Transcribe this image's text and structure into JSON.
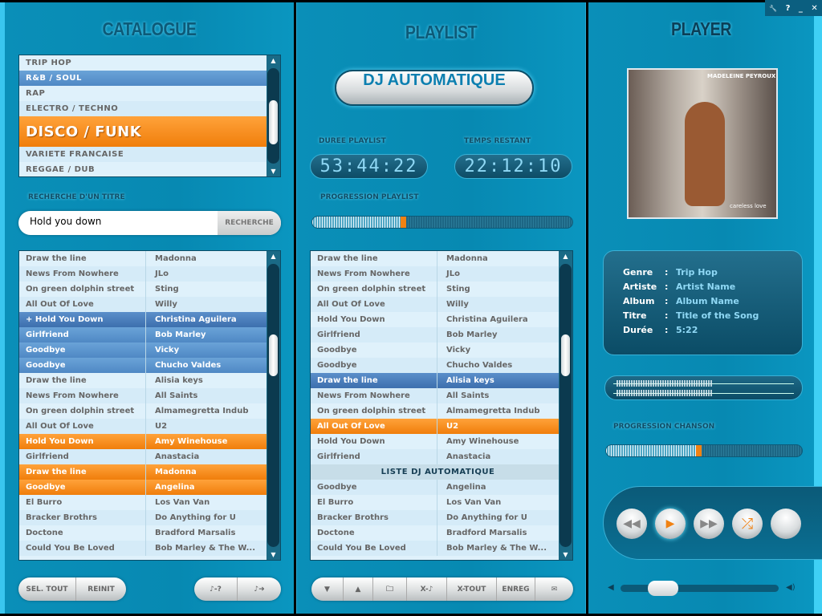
{
  "catalogue": {
    "title": "CATALOGUE",
    "genres": [
      {
        "label": "TRIP HOP",
        "state": ""
      },
      {
        "label": "R&B / SOUL",
        "state": "blue"
      },
      {
        "label": "RAP",
        "state": ""
      },
      {
        "label": "ELECTRO / TECHNO",
        "state": ""
      },
      {
        "label": "DISCO / FUNK",
        "state": "orange"
      },
      {
        "label": "VARIETE FRANCAISE",
        "state": ""
      },
      {
        "label": "REGGAE / DUB",
        "state": ""
      }
    ],
    "search_label": "RECHERCHE D'UN TITRE",
    "search_value": "Hold you down",
    "search_button": "RECHERCHE",
    "tracks": [
      [
        "Draw the line",
        "Madonna",
        ""
      ],
      [
        "News From Nowhere",
        "JLo",
        ""
      ],
      [
        "On green dolphin street",
        "Sting",
        ""
      ],
      [
        "All Out Of Love",
        "Willy",
        ""
      ],
      [
        "+ Hold You Down",
        "Christina Aguilera",
        "sel"
      ],
      [
        "Girlfriend",
        "Bob Marley",
        "blue"
      ],
      [
        "Goodbye",
        "Vicky",
        "blue"
      ],
      [
        "Goodbye",
        "Chucho Valdes",
        "blue"
      ],
      [
        "Draw the line",
        "Alisia keys",
        ""
      ],
      [
        "News From Nowhere",
        "All Saints",
        ""
      ],
      [
        "On green dolphin street",
        "Almamegretta Indub",
        ""
      ],
      [
        "All Out Of Love",
        "U2",
        ""
      ],
      [
        "Hold You Down",
        "Amy Winehouse",
        "orange"
      ],
      [
        "Girlfriend",
        "Anastacia",
        ""
      ],
      [
        "Draw the line",
        "Madonna",
        "orange"
      ],
      [
        "Goodbye",
        "Angelina",
        "orange"
      ],
      [
        "El Burro",
        "Los Van Van",
        ""
      ],
      [
        "Bracker Brothrs",
        "Do Anything for U",
        ""
      ],
      [
        "Doctone",
        "Bradford Marsalis",
        ""
      ],
      [
        "Could You Be Loved",
        "Bob Marley & The W...",
        ""
      ]
    ],
    "buttons": {
      "select_all": "SEL. TOUT",
      "reset": "REINIT",
      "note_query": "♪-?",
      "note_send": "♪➜"
    }
  },
  "playlist": {
    "title": "PLAYLIST",
    "dj_button": "DJ AUTOMATIQUE",
    "duration_label": "DUREE PLAYLIST",
    "duration": "53:44:22",
    "remaining_label": "TEMPS RESTANT",
    "remaining": "22:12:10",
    "progress_label": "PROGRESSION PLAYLIST",
    "progress_percent": 34,
    "tracks": [
      [
        "Draw the line",
        "Madonna",
        ""
      ],
      [
        "News From Nowhere",
        "JLo",
        ""
      ],
      [
        "On green dolphin street",
        "Sting",
        ""
      ],
      [
        "All Out Of Love",
        "Willy",
        ""
      ],
      [
        "Hold You Down",
        "Christina Aguilera",
        ""
      ],
      [
        "Girlfriend",
        "Bob Marley",
        ""
      ],
      [
        "Goodbye",
        "Vicky",
        ""
      ],
      [
        "Goodbye",
        "Chucho Valdes",
        ""
      ],
      [
        "Draw the line",
        "Alisia keys",
        "sel"
      ],
      [
        "News From Nowhere",
        "All Saints",
        ""
      ],
      [
        "On green dolphin street",
        "Almamegretta Indub",
        ""
      ],
      [
        "All Out Of Love",
        "U2",
        "orange"
      ],
      [
        "Hold You Down",
        "Amy Winehouse",
        ""
      ],
      [
        "Girlfriend",
        "Anastacia",
        ""
      ],
      [
        "LISTE DJ AUTOMATIQUE",
        "",
        "head"
      ],
      [
        "Goodbye",
        "Angelina",
        ""
      ],
      [
        "El Burro",
        "Los Van Van",
        ""
      ],
      [
        "Bracker Brothrs",
        "Do Anything for U",
        ""
      ],
      [
        "Doctone",
        "Bradford Marsalis",
        ""
      ],
      [
        "Could You Be Loved",
        "Bob Marley & The W...",
        ""
      ]
    ],
    "toolbar": {
      "down": "▼",
      "up": "▲",
      "folder": "🗀",
      "remove": "X-♪",
      "remove_all": "X-TOUT",
      "save": "ENREG",
      "mail": "✉"
    }
  },
  "player": {
    "title": "PLAYER",
    "album_art_text": "MADELEINE PEYROUX",
    "album_art_sub": "careless love",
    "info": [
      {
        "label": "Genre",
        "value": "Trip Hop"
      },
      {
        "label": "Artiste",
        "value": "Artist Name"
      },
      {
        "label": "Album",
        "value": "Album Name"
      },
      {
        "label": "Titre",
        "value": "Title of the Song"
      },
      {
        "label": "Durée",
        "value": "5:22"
      }
    ],
    "song_progress_label": "PROGRESSION CHANSON",
    "song_progress_percent": 46,
    "volume_percent": 27,
    "controls": {
      "rewind": "◀◀",
      "play": "▶",
      "forward": "▶▶",
      "shuffle": "⤮"
    }
  },
  "window": {
    "settings": "🔧",
    "help": "?",
    "minimize": "_",
    "close": "✕"
  },
  "colors": {
    "accent": "#f08213",
    "panel": "#0789b2",
    "selected": "#4f88c4"
  }
}
